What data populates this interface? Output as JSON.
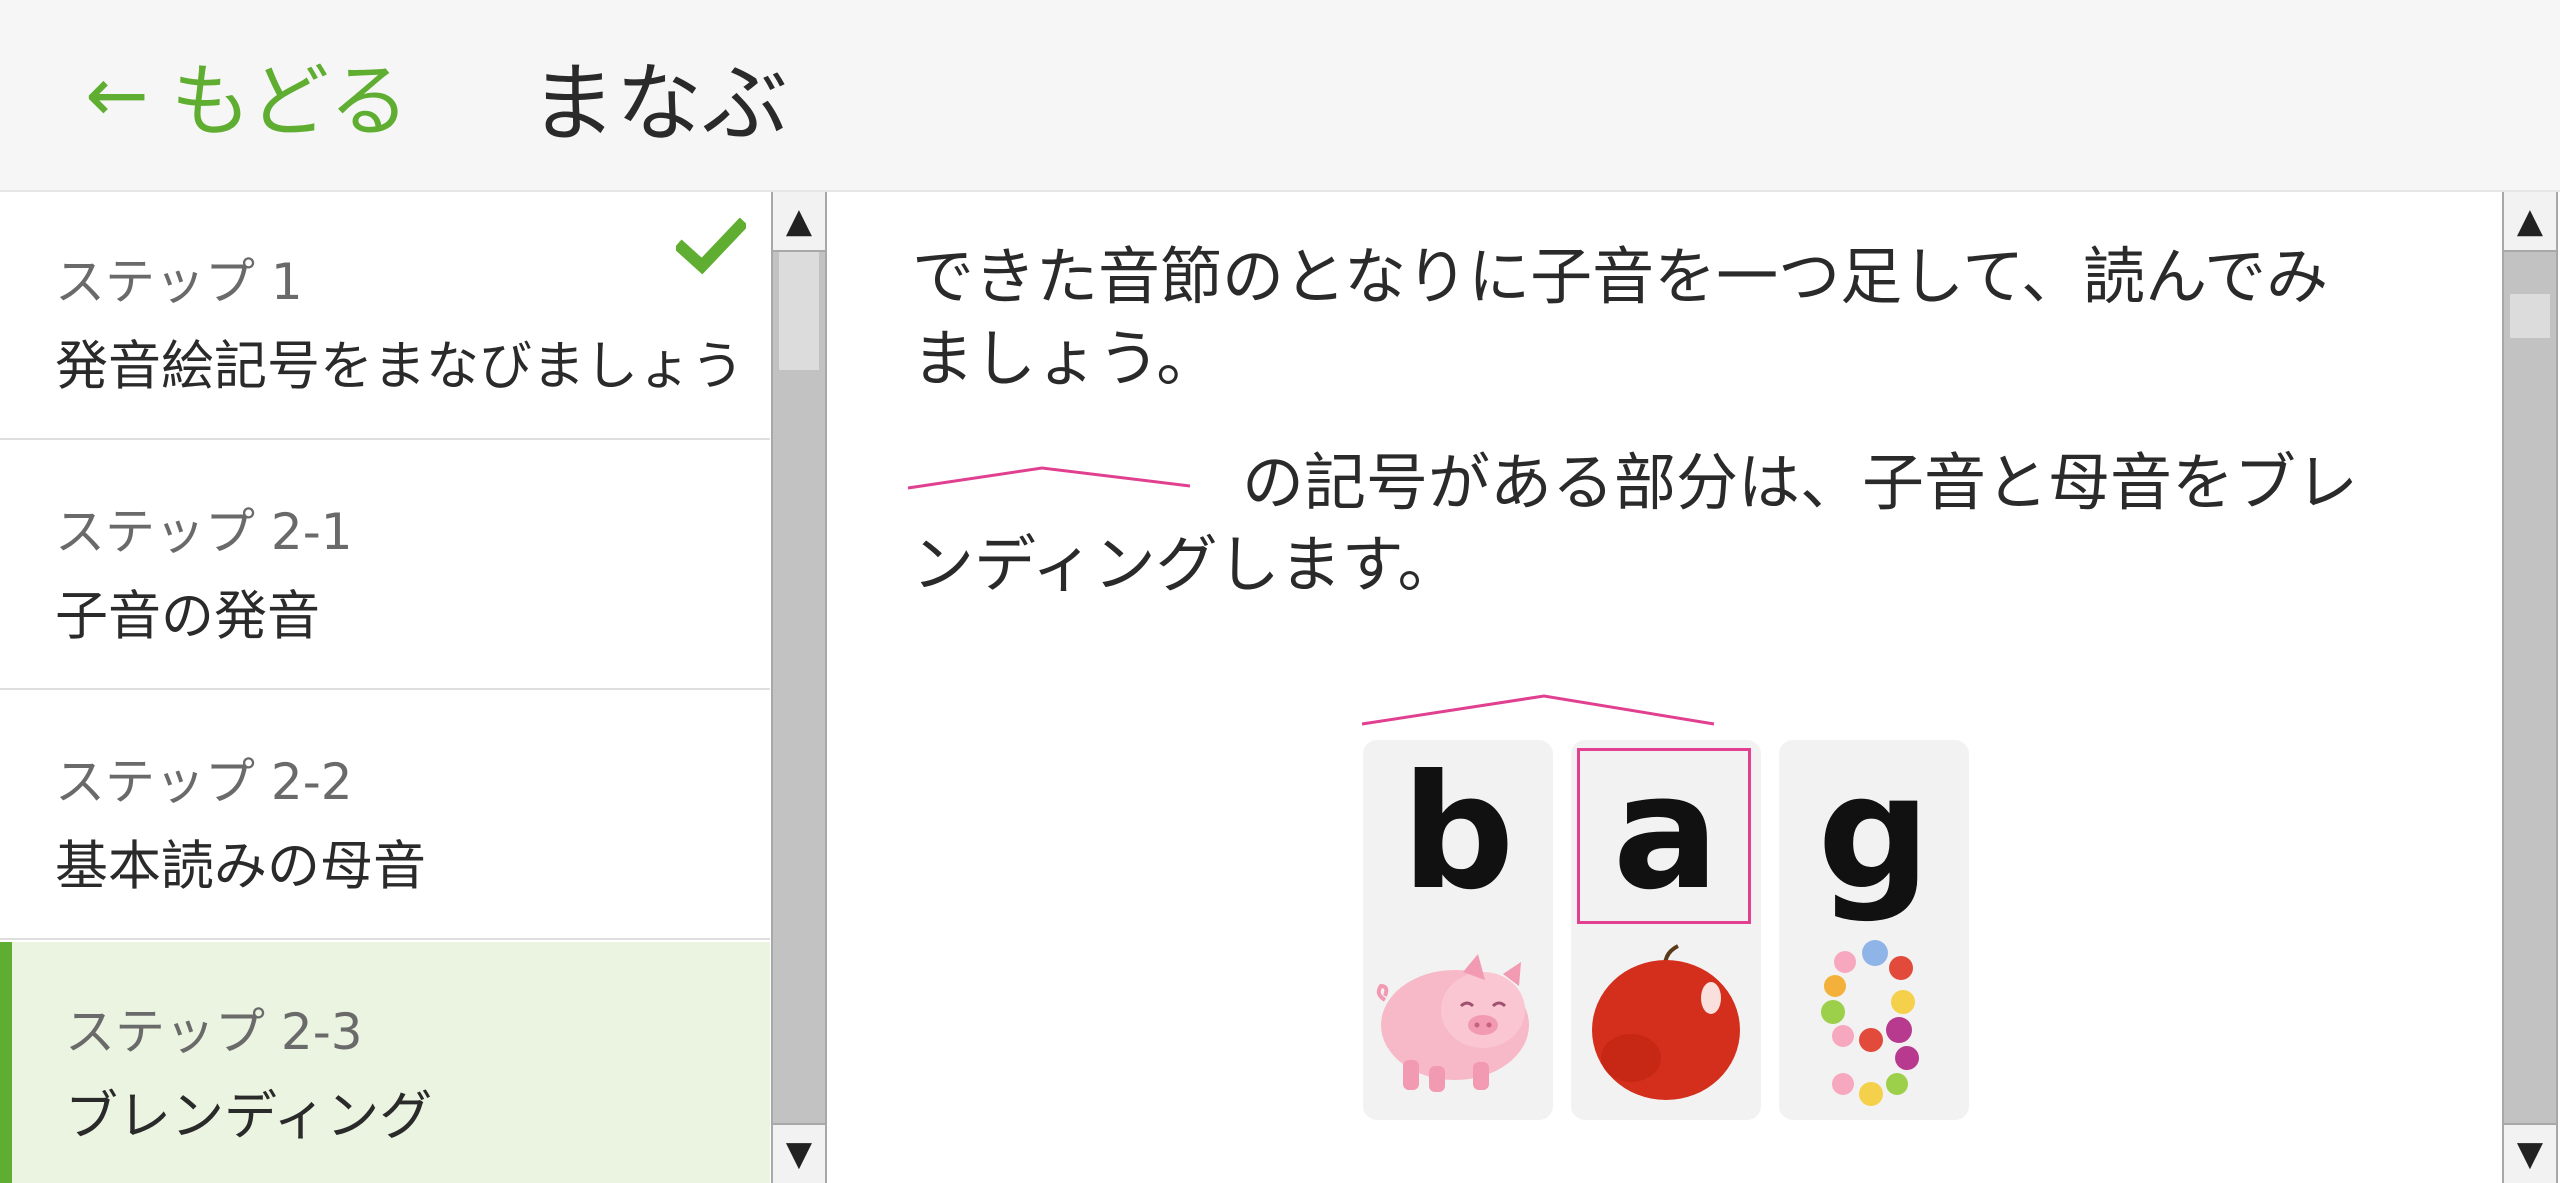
{
  "header": {
    "back_arrow": "←",
    "back_label": "もどる",
    "title": "まなぶ"
  },
  "sidebar": {
    "items": [
      {
        "step": "ステップ 1",
        "name": "発音絵記号をまなびましょう",
        "completed": true
      },
      {
        "step": "ステップ 2-1",
        "name": "子音の発音"
      },
      {
        "step": "ステップ 2-2",
        "name": "基本読みの母音"
      },
      {
        "step": "ステップ 2-3",
        "name": "ブレンディング",
        "active": true
      }
    ]
  },
  "scrollbar_glyphs": {
    "up": "▲",
    "down": "▼"
  },
  "content": {
    "paragraph1": "できた音節のとなりに子音を一つ足して、読んでみましょう。",
    "paragraph2_tail": "の記号がある部分は、子音と母音をブレンディングします。",
    "cards": [
      {
        "letter": "b",
        "picture": "pig"
      },
      {
        "letter": "a",
        "picture": "apple",
        "highlighted": true
      },
      {
        "letter": "g",
        "picture": "jellybeans-shaped-g"
      }
    ]
  },
  "colors": {
    "accent_green": "#5fae32",
    "active_bg": "#eaf4e0",
    "blend_mark_pink": "#e0408f",
    "apple_red": "#d42e1c",
    "pig_pink": "#f7b9c8"
  }
}
